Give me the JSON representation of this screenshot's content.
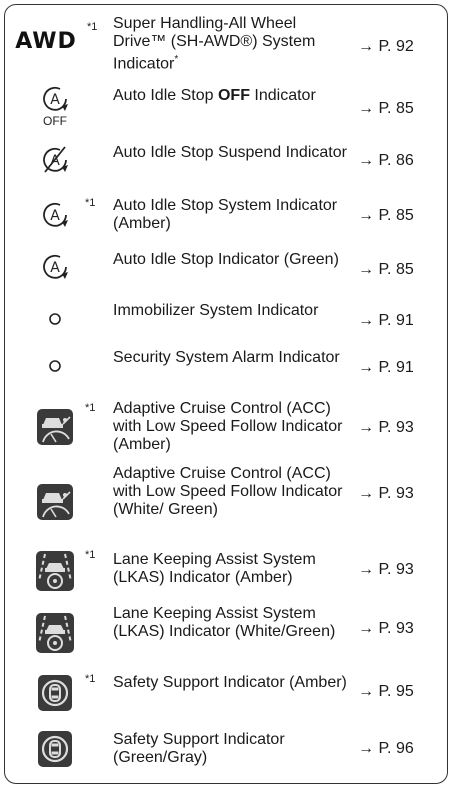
{
  "rows": [
    {
      "icon": "awd-text-icon",
      "icon_text": "AWD",
      "note": "*1",
      "desc": "Super Handling-All Wheel Drive™ (SH-AWD®) System Indicator",
      "desc_suffix": "*",
      "page": "→ P. 92"
    },
    {
      "icon": "auto-idle-stop-off-icon",
      "icon_text": "OFF",
      "note": "",
      "desc_a": "Auto Idle Stop ",
      "desc_bold": "OFF",
      "desc_b": " Indicator",
      "page": "→ P. 85"
    },
    {
      "icon": "auto-idle-stop-suspend-icon",
      "note": "",
      "desc": "Auto Idle Stop Suspend Indicator",
      "page": "→ P. 86"
    },
    {
      "icon": "auto-idle-stop-system-icon",
      "note": "*1",
      "desc": "Auto Idle Stop System Indicator (Amber)",
      "page": "→ P. 85"
    },
    {
      "icon": "auto-idle-stop-icon",
      "note": "",
      "desc": "Auto Idle Stop Indicator (Green)",
      "page": "→ P. 85"
    },
    {
      "icon": "immobilizer-icon",
      "note": "",
      "desc": "Immobilizer System Indicator",
      "page": "→ P. 91"
    },
    {
      "icon": "security-alarm-icon",
      "note": "",
      "desc": "Security System Alarm Indicator",
      "page": "→ P. 91"
    },
    {
      "icon": "acc-low-speed-icon",
      "note": "*1",
      "desc": "Adaptive Cruise Control (ACC) with Low Speed Follow Indicator (Amber)",
      "page": "→ P. 93"
    },
    {
      "icon": "acc-low-speed-icon",
      "note": "",
      "desc": "Adaptive Cruise Control (ACC) with Low Speed Follow Indicator (White/ Green)",
      "page": "→ P. 93"
    },
    {
      "icon": "lkas-icon",
      "note": "*1",
      "desc": "Lane Keeping Assist System (LKAS) Indicator (Amber)",
      "page": "→ P. 93"
    },
    {
      "icon": "lkas-icon",
      "note": "",
      "desc": "Lane Keeping Assist System (LKAS) Indicator (White/Green)",
      "page": "→ P. 93"
    },
    {
      "icon": "safety-support-icon",
      "note": "*1",
      "desc": "Safety Support Indicator (Amber)",
      "page": "→ P. 95"
    },
    {
      "icon": "safety-support-icon",
      "note": "",
      "desc": "Safety Support Indicator (Green/Gray)",
      "page": "→ P. 96"
    }
  ]
}
